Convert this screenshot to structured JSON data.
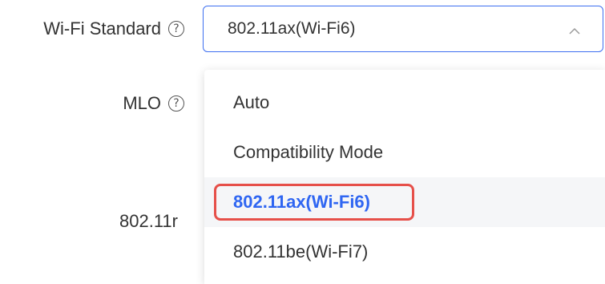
{
  "form": {
    "wifi_standard_label": "Wi-Fi Standard",
    "mlo_label": "MLO",
    "r_label": "802.11r",
    "help_glyph": "?"
  },
  "select": {
    "value": "802.11ax(Wi-Fi6)",
    "state": "open",
    "chevron_icon": "chevron-up-icon"
  },
  "dropdown": {
    "options": [
      {
        "label": "Auto"
      },
      {
        "label": "Compatibility Mode"
      },
      {
        "label": "802.11ax(Wi-Fi6)",
        "selected": true
      },
      {
        "label": "802.11be(Wi-Fi7)"
      }
    ]
  },
  "colors": {
    "accent_blue": "#2f66f2",
    "select_border": "#3d6ff0",
    "annotation_red": "#e6504a",
    "hover_bg": "#f5f6f8",
    "text": "#333333"
  }
}
